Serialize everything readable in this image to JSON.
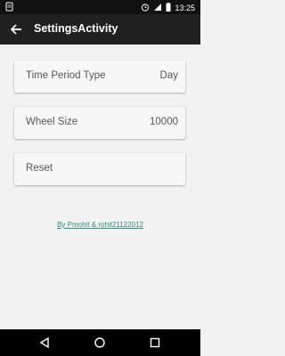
{
  "status_bar": {
    "time": "13:25",
    "icons": [
      "notification-icon",
      "alarm-icon",
      "signal-icon",
      "battery-icon"
    ]
  },
  "app_bar": {
    "title": "SettingsActivity",
    "back_icon": "arrow-back-icon"
  },
  "settings": [
    {
      "label": "Time Period Type",
      "value": "Day"
    },
    {
      "label": "Wheel Size",
      "value": "10000"
    },
    {
      "label": "Reset",
      "value": ""
    }
  ],
  "credit_link": "By Pmohit & rohit21122012",
  "nav_bar": {
    "icons": [
      "back-triangle-icon",
      "home-circle-icon",
      "recents-square-icon"
    ]
  },
  "colors": {
    "background": "#f2f2f2",
    "app_bar": "#202020",
    "status_bar": "#111111",
    "link": "#2d8a7c"
  }
}
